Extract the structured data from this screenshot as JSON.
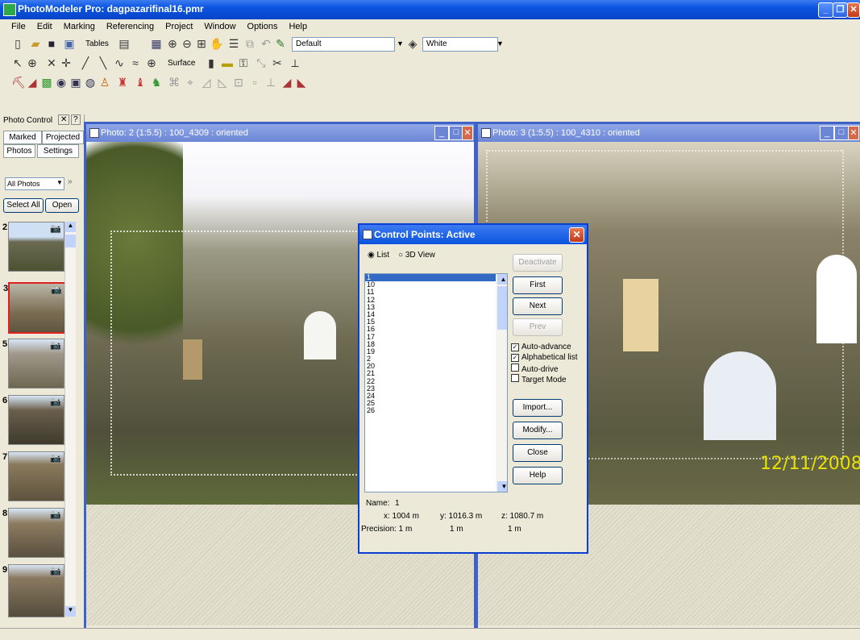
{
  "app": {
    "title": "PhotoModeler Pro: dagpazarifinal16.pmr"
  },
  "menu": [
    "File",
    "Edit",
    "Marking",
    "Referencing",
    "Project",
    "Window",
    "Options",
    "Help"
  ],
  "toolbar": {
    "tables_label": "Tables",
    "surface_label": "Surface",
    "default_combo": "Default",
    "color_combo": "White"
  },
  "left": {
    "title": "Photo Control",
    "tabs": [
      "Marked",
      "Projected",
      "Photos",
      "Settings"
    ],
    "filter": "All Photos",
    "select_all": "Select All",
    "open": "Open",
    "thumbs": [
      "2",
      "3",
      "5",
      "6",
      "7",
      "8",
      "9"
    ]
  },
  "photo1": {
    "title": "Photo: 2 (1:5.5) : 100_4309 : oriented"
  },
  "photo2": {
    "title": "Photo: 3 (1:5.5) : 100_4310 : oriented",
    "datestamp": "12/11/2008"
  },
  "dialog": {
    "title": "Control Points: Active",
    "mode_list": "List",
    "mode_3d": "3D View",
    "list": [
      "1",
      "10",
      "11",
      "12",
      "13",
      "14",
      "15",
      "16",
      "17",
      "18",
      "19",
      "2",
      "20",
      "21",
      "22",
      "23",
      "24",
      "25",
      "26"
    ],
    "buttons": {
      "deactivate": "Deactivate",
      "first": "First",
      "next": "Next",
      "prev": "Prev",
      "import": "Import...",
      "modify": "Modify...",
      "close": "Close",
      "help": "Help"
    },
    "checks": {
      "auto_advance": "Auto-advance",
      "alpha": "Alphabetical list",
      "auto_drive": "Auto-drive",
      "target": "Target Mode"
    },
    "name_label": "Name:",
    "name_value": "1",
    "x": "x: 1004 m",
    "y": "y: 1016.3 m",
    "z": "z: 1080.7 m",
    "precision_label": "Precision: 1 m",
    "prec_y": "1 m",
    "prec_z": "1 m"
  }
}
